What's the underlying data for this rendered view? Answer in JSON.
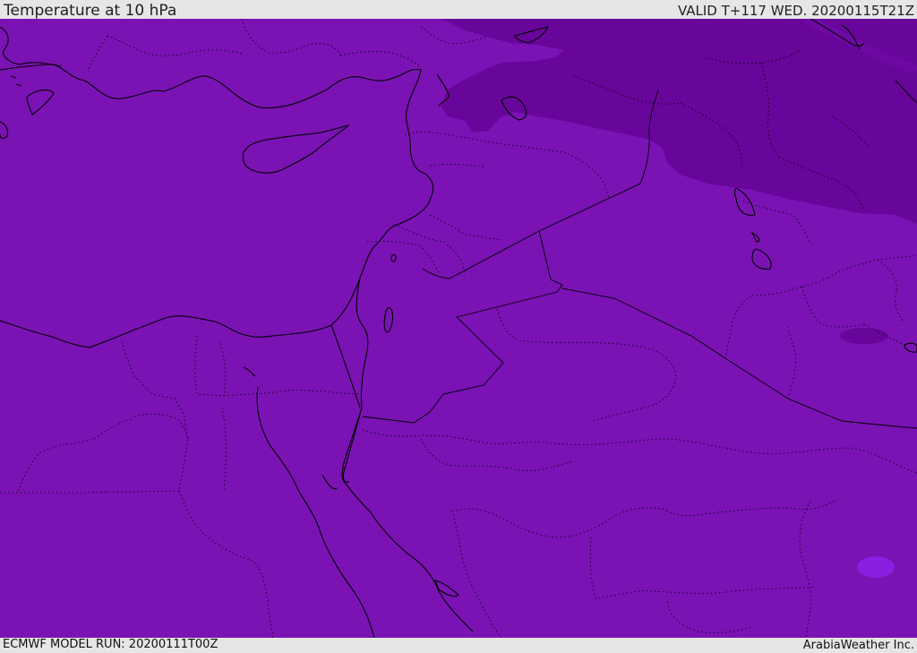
{
  "header": {
    "title": "Temperature at 10 hPa",
    "valid": "VALID T+117 WED. 20200115T21Z"
  },
  "footer": {
    "model_run": "ECMWF MODEL RUN: 20200111T00Z",
    "credit": "ArabiaWeather Inc."
  },
  "map": {
    "colors": {
      "base_field": "#7a12b4",
      "cold_field": "#68059a",
      "warm_spot": "#8a1ee0",
      "coastline": "#000000",
      "border": "#000000"
    }
  }
}
